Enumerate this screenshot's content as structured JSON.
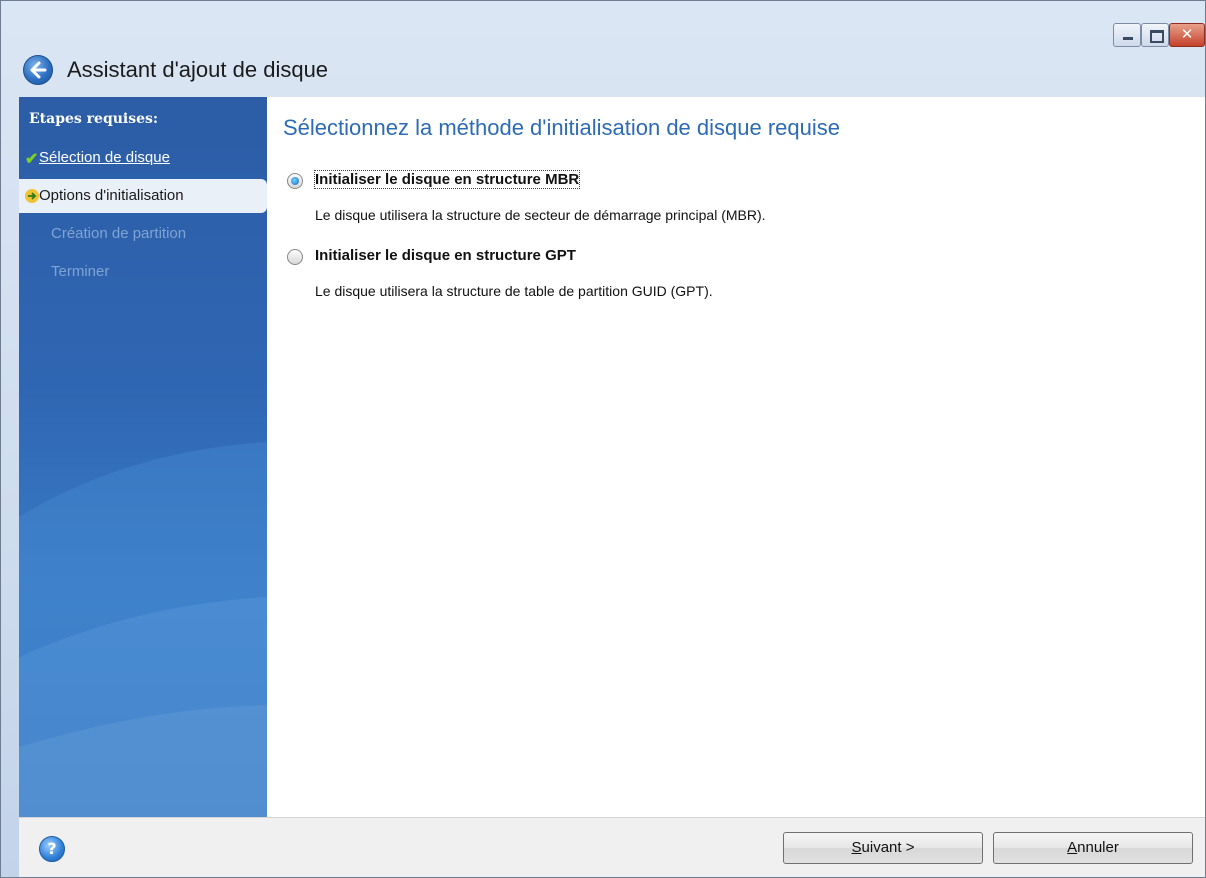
{
  "window": {
    "title": "Assistant d'ajout de disque",
    "close_glyph": "✕"
  },
  "sidebar": {
    "heading": "Etapes requises:",
    "steps": [
      {
        "label": "Sélection de disque",
        "state": "done",
        "icon": "check-icon"
      },
      {
        "label": "Options d'initialisation",
        "state": "current",
        "icon": "arrow-right-icon"
      },
      {
        "label": "Création de partition",
        "state": "pending"
      },
      {
        "label": "Terminer",
        "state": "pending"
      }
    ]
  },
  "main": {
    "heading": "Sélectionnez la méthode d'initialisation de disque requise",
    "options": [
      {
        "label": "Initialiser le disque en structure MBR",
        "description": "Le disque utilisera la structure de secteur de démarrage principal (MBR).",
        "selected": true
      },
      {
        "label": "Initialiser le disque en structure GPT",
        "description": "Le disque utilisera la structure de table de partition GUID (GPT).",
        "selected": false
      }
    ]
  },
  "footer": {
    "help_glyph": "?",
    "next_mnemonic": "S",
    "next_rest": "uivant >",
    "cancel_mnemonic": "A",
    "cancel_rest": "nnuler"
  },
  "colors": {
    "heading": "#2d6bb5",
    "sidebar": "#2f66b3",
    "done_check": "#7ed321"
  }
}
